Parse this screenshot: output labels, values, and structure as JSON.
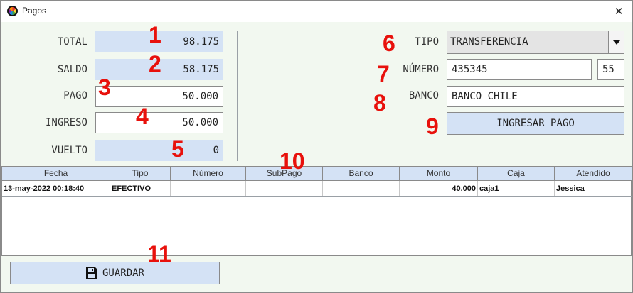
{
  "window": {
    "title": "Pagos",
    "close_glyph": "✕",
    "icon": "app-color-wheel-icon"
  },
  "left_panel": {
    "total": {
      "label": "TOTAL",
      "value": "98.175"
    },
    "saldo": {
      "label": "SALDO",
      "value": "58.175"
    },
    "pago": {
      "label": "PAGO",
      "value": "50.000"
    },
    "ingreso": {
      "label": "INGRESO",
      "value": "50.000"
    },
    "vuelto": {
      "label": "VUELTO",
      "value": "0"
    }
  },
  "right_panel": {
    "tipo": {
      "label": "TIPO",
      "value": "TRANSFERENCIA"
    },
    "numero": {
      "label": "NÚMERO",
      "value": "435345",
      "extra": "55"
    },
    "banco": {
      "label": "BANCO",
      "value": "BANCO CHILE"
    },
    "ingresar_label": "INGRESAR PAGO"
  },
  "table": {
    "columns": [
      "Fecha",
      "Tipo",
      "Número",
      "SubPago",
      "Banco",
      "Monto",
      "Caja",
      "Atendido"
    ],
    "rows": [
      [
        "13-may-2022 00:18:40",
        "EFECTIVO",
        "",
        "",
        "",
        "40.000",
        "caja1",
        "Jessica"
      ]
    ]
  },
  "save_label": "GUARDAR",
  "annotations": [
    "1",
    "2",
    "3",
    "4",
    "5",
    "6",
    "7",
    "8",
    "9",
    "10",
    "11"
  ],
  "colors": {
    "readonly_bg": "#d4e2f5",
    "annotation": "#e8110c",
    "window_bg": "#f2f8f0"
  }
}
